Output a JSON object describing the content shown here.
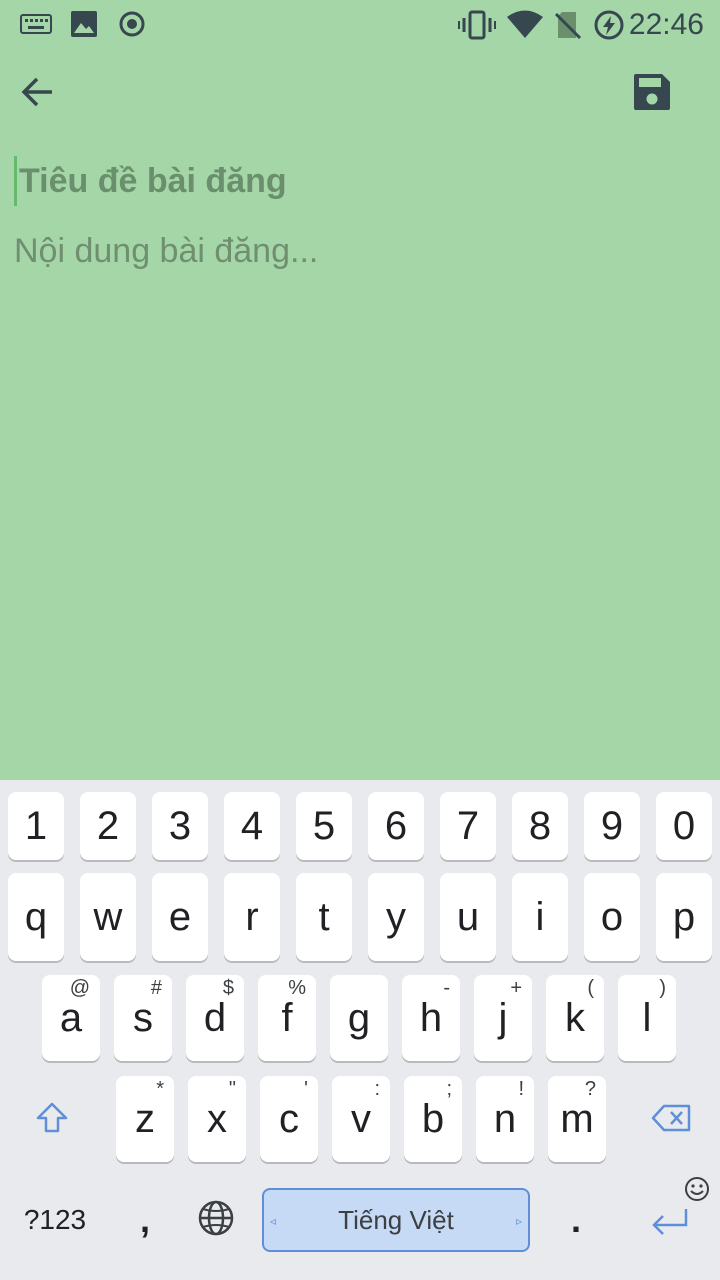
{
  "status_bar": {
    "time": "22:46",
    "icons": [
      "keyboard-icon",
      "image-icon",
      "record-icon",
      "vibrate-icon",
      "wifi-icon",
      "no-sim-icon",
      "battery-charging-icon"
    ]
  },
  "toolbar": {
    "back_icon": "arrow-back-icon",
    "save_icon": "floppy-save-icon"
  },
  "editor": {
    "title_placeholder": "Tiêu đề bài đăng",
    "content_placeholder": "Nội dung bài đăng..."
  },
  "colors": {
    "background": "#a5d6a7",
    "keyboard": "#e8eaed",
    "accent": "#5f8fd9"
  },
  "keyboard": {
    "number_row": [
      "1",
      "2",
      "3",
      "4",
      "5",
      "6",
      "7",
      "8",
      "9",
      "0"
    ],
    "row1": [
      "q",
      "w",
      "e",
      "r",
      "t",
      "y",
      "u",
      "i",
      "o",
      "p"
    ],
    "row2": [
      {
        "label": "a",
        "hint": "@"
      },
      {
        "label": "s",
        "hint": "#"
      },
      {
        "label": "d",
        "hint": "$"
      },
      {
        "label": "f",
        "hint": "%"
      },
      {
        "label": "g",
        "hint": ""
      },
      {
        "label": "h",
        "hint": "-"
      },
      {
        "label": "j",
        "hint": "+"
      },
      {
        "label": "k",
        "hint": "("
      },
      {
        "label": "l",
        "hint": ")"
      }
    ],
    "row3": [
      {
        "label": "z",
        "hint": "*"
      },
      {
        "label": "x",
        "hint": "\""
      },
      {
        "label": "c",
        "hint": "'"
      },
      {
        "label": "v",
        "hint": ":"
      },
      {
        "label": "b",
        "hint": ";"
      },
      {
        "label": "n",
        "hint": "!"
      },
      {
        "label": "m",
        "hint": "?"
      }
    ],
    "symbols_label": "?123",
    "comma_label": ",",
    "space_label": "Tiếng Việt",
    "period_label": "."
  }
}
